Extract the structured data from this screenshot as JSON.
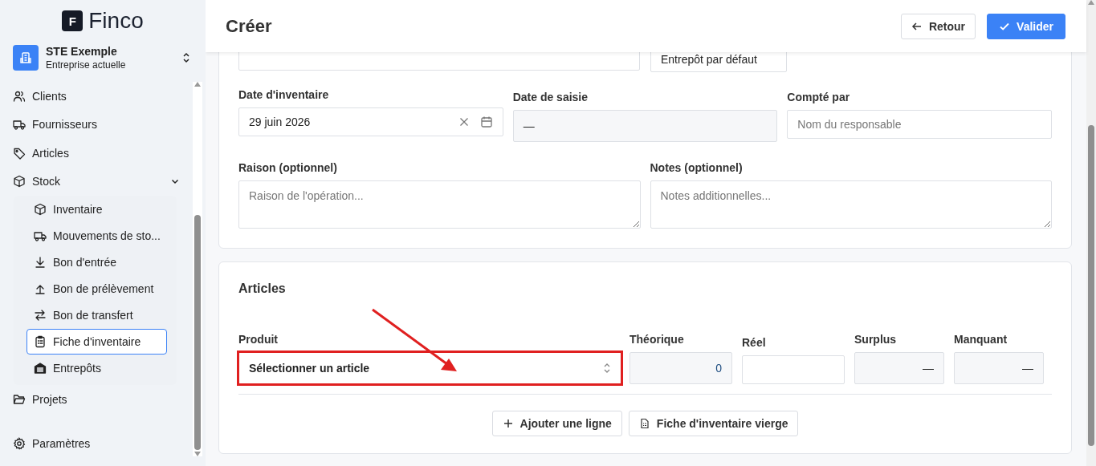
{
  "logo": {
    "mark": "F",
    "name": "Finco"
  },
  "company": {
    "name": "STE Exemple",
    "subtitle": "Entreprise actuelle"
  },
  "sidebar": {
    "items": [
      {
        "label": "Clients",
        "selected": false
      },
      {
        "label": "Fournisseurs",
        "selected": false
      },
      {
        "label": "Articles",
        "selected": false
      },
      {
        "label": "Stock",
        "selected": false,
        "expanded": true,
        "children": [
          {
            "label": "Inventaire",
            "selected": false
          },
          {
            "label": "Mouvements de sto...",
            "selected": false
          },
          {
            "label": "Bon d'entrée",
            "selected": false
          },
          {
            "label": "Bon de prélèvement",
            "selected": false
          },
          {
            "label": "Bon de transfert",
            "selected": false
          },
          {
            "label": "Fiche d'inventaire",
            "selected": true
          },
          {
            "label": "Entrepôts",
            "selected": false
          }
        ]
      },
      {
        "label": "Projets",
        "selected": false
      }
    ],
    "footer": {
      "label": "Paramètres",
      "selected": false
    }
  },
  "header": {
    "title": "Créer",
    "buttons": [
      {
        "label": "Retour",
        "kind": "secondary"
      },
      {
        "label": "Valider",
        "kind": "primary"
      }
    ]
  },
  "form": {
    "warehouse": {
      "value": "Entrepôt par défaut"
    },
    "fields": [
      {
        "label": "Date d'inventaire",
        "kind": "date",
        "value": "29 juin 2026"
      },
      {
        "label": "Date de saisie",
        "kind": "readonly",
        "value": "—"
      },
      {
        "label": "Compté par",
        "kind": "text",
        "placeholder": "Nom du responsable"
      }
    ],
    "textareas": [
      {
        "label": "Raison (optionnel)",
        "placeholder": "Raison de l'opération..."
      },
      {
        "label": "Notes (optionnel)",
        "placeholder": "Notes additionnelles..."
      }
    ]
  },
  "articles": {
    "title": "Articles",
    "columns": [
      {
        "label": "Produit",
        "kind": "select",
        "value": "Sélectionner un article"
      },
      {
        "label": "Théorique",
        "kind": "readonly",
        "value": "0"
      },
      {
        "label": "Réel",
        "kind": "input"
      },
      {
        "label": "Surplus",
        "kind": "readonly",
        "value": "—"
      },
      {
        "label": "Manquant",
        "kind": "readonly",
        "value": "—"
      }
    ],
    "buttons": [
      {
        "label": "Ajouter une ligne"
      },
      {
        "label": "Fiche d'inventaire vierge"
      }
    ]
  }
}
